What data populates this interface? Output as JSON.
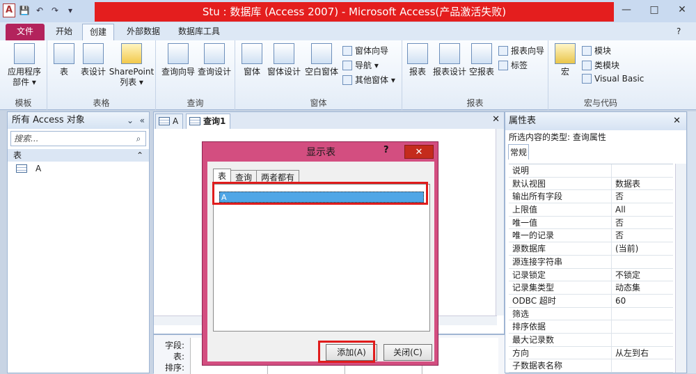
{
  "window": {
    "title": "Stu : 数据库 (Access 2007) - Microsoft Access(产品激活失败)",
    "controls": {
      "minimize": "—",
      "maximize": "□",
      "close": "✕"
    }
  },
  "qat": {
    "app_icon": "A",
    "save": "💾",
    "undo": "↶",
    "redo": "↷",
    "customize": "▾"
  },
  "tabs": {
    "file": "文件",
    "home": "开始",
    "create": "创建",
    "external": "外部数据",
    "dbtools": "数据库工具"
  },
  "ribbon": {
    "groups": {
      "templates": {
        "label": "模板",
        "app_parts_line1": "应用程序",
        "app_parts_line2": "部件 ▾"
      },
      "tables": {
        "label": "表格",
        "table": "表",
        "table_design": "表设计",
        "sharepoint_line1": "SharePoint",
        "sharepoint_line2": "列表 ▾"
      },
      "queries": {
        "label": "查询",
        "query_wizard": "查询向导",
        "query_design": "查询设计"
      },
      "forms": {
        "label": "窗体",
        "form": "窗体",
        "form_design": "窗体设计",
        "blank_form": "空白窗体",
        "form_wizard": "窗体向导",
        "navigation": "导航 ▾",
        "more_forms": "其他窗体 ▾"
      },
      "reports": {
        "label": "报表",
        "report": "报表",
        "report_design": "报表设计",
        "blank_report": "空报表",
        "report_wizard": "报表向导",
        "labels": "标签"
      },
      "macros": {
        "label": "宏与代码",
        "macro": "宏",
        "module": "模块",
        "class_module": "类模块",
        "vba": "Visual Basic"
      }
    }
  },
  "nav_pane": {
    "title": "所有 Access 对象",
    "search_placeholder": "搜索...",
    "section": "表",
    "items": [
      {
        "label": "A"
      }
    ]
  },
  "document": {
    "tabs": [
      {
        "label": "A"
      },
      {
        "label": "查询1"
      }
    ],
    "grid_labels": {
      "field": "字段:",
      "table": "表:",
      "sort": "排序:"
    }
  },
  "property_sheet": {
    "title": "属性表",
    "selection_type": "所选内容的类型: 查询属性",
    "tab": "常规",
    "rows": [
      {
        "key": "说明",
        "value": ""
      },
      {
        "key": "默认视图",
        "value": "数据表"
      },
      {
        "key": "输出所有字段",
        "value": "否"
      },
      {
        "key": "上限值",
        "value": "All"
      },
      {
        "key": "唯一值",
        "value": "否"
      },
      {
        "key": "唯一的记录",
        "value": "否"
      },
      {
        "key": "源数据库",
        "value": "(当前)"
      },
      {
        "key": "源连接字符串",
        "value": ""
      },
      {
        "key": "记录锁定",
        "value": "不锁定"
      },
      {
        "key": "记录集类型",
        "value": "动态集"
      },
      {
        "key": "ODBC 超时",
        "value": "60"
      },
      {
        "key": "筛选",
        "value": ""
      },
      {
        "key": "排序依据",
        "value": ""
      },
      {
        "key": "最大记录数",
        "value": ""
      },
      {
        "key": "方向",
        "value": "从左到右"
      },
      {
        "key": "子数据表名称",
        "value": ""
      }
    ]
  },
  "dialog": {
    "title": "显示表",
    "help": "?",
    "close": "✕",
    "tabs": [
      "表",
      "查询",
      "两者都有"
    ],
    "list_items": [
      "A"
    ],
    "add_button": "添加(A)",
    "close_button": "关闭(C)"
  },
  "colors": {
    "title_highlight": "#e41e1e",
    "file_tab": "#b3235c",
    "dialog_frame": "#d34e80",
    "annotation": "#e01c1c"
  }
}
